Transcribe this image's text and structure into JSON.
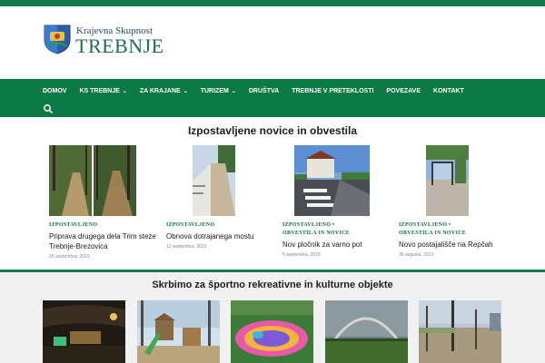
{
  "colors": {
    "brand_green": "#0b7a44",
    "accent_green": "#0f6f42",
    "bottom_bg": "#f1f1f1"
  },
  "logo": {
    "line1": "Krajevna Skupnost",
    "line2": "TREBNJE",
    "icon": "crest-shield-icon"
  },
  "nav": {
    "items": [
      {
        "label": "DOMOV",
        "has_dropdown": false
      },
      {
        "label": "KS TREBNJE",
        "has_dropdown": true
      },
      {
        "label": "ZA KRAJANE",
        "has_dropdown": true
      },
      {
        "label": "TURIZEM",
        "has_dropdown": true
      },
      {
        "label": "DRUŠTVA",
        "has_dropdown": false
      },
      {
        "label": "TREBNJE V PRETEKLOSTI",
        "has_dropdown": false
      },
      {
        "label": "POVEZAVE",
        "has_dropdown": false
      },
      {
        "label": "KONTAKT",
        "has_dropdown": false
      }
    ],
    "chevron": "⌄",
    "search_icon": "search-icon"
  },
  "featured": {
    "heading": "Izpostavljene novice in obvestila",
    "cards": [
      {
        "category": "IZPOSTAVLJENO",
        "category2": "",
        "title": "Priprava drugega dela Trim steze Trebnje-Brezovica",
        "date": "20 septembra, 2023"
      },
      {
        "category": "IZPOSTAVLJENO",
        "category2": "",
        "title": "Obnova dotrajanega mostu",
        "date": "12 septembra, 2023"
      },
      {
        "category": "IZPOSTAVLJENO •",
        "category2": "OBVESTILA IN NOVICE",
        "title": "Nov pločnik za varno pot",
        "date": "5 septembra, 2023"
      },
      {
        "category": "IZPOSTAVLJENO •",
        "category2": "OBVESTILA IN NOVICE",
        "title": "Novo postajališče na Repčah",
        "date": "30 avgusta, 2023"
      }
    ]
  },
  "facilities": {
    "heading": "Skrbimo za športno rekreativne in kulturne objekte"
  }
}
